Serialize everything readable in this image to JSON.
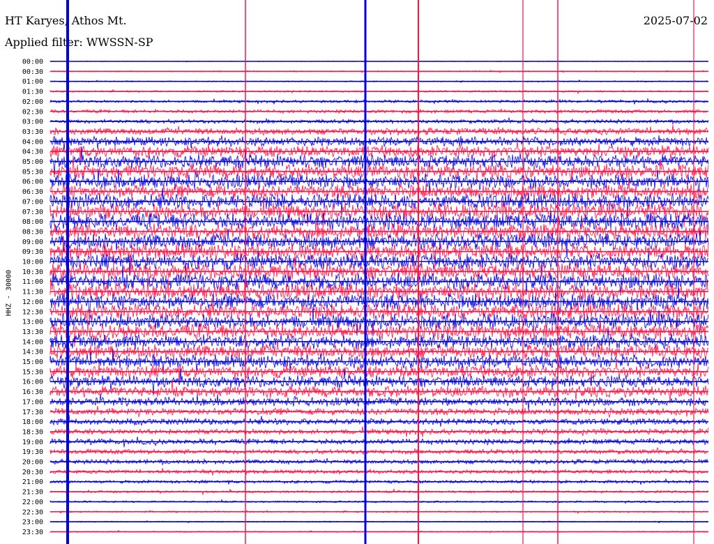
{
  "header": {
    "station": "HT Karyes, Athos Mt.",
    "filter": "Applied filter: WWSSN-SP",
    "date": "2025-07-02"
  },
  "chart_data": {
    "type": "line",
    "title": "HT Karyes, Athos Mt.",
    "subtitle": "Applied filter: WWSSN-SP",
    "date": "2025-07-02",
    "ylabel": "HHZ - 30000",
    "row_labels": [
      "00:00",
      "00:30",
      "01:00",
      "01:30",
      "02:00",
      "02:30",
      "03:00",
      "03:30",
      "04:00",
      "04:30",
      "05:00",
      "05:30",
      "06:00",
      "06:30",
      "07:00",
      "07:30",
      "08:00",
      "08:30",
      "09:00",
      "09:30",
      "10:00",
      "10:30",
      "11:00",
      "11:30",
      "12:00",
      "12:30",
      "13:00",
      "13:30",
      "14:00",
      "14:30",
      "15:00",
      "15:30",
      "16:00",
      "16:30",
      "17:00",
      "17:30",
      "18:00",
      "18:30",
      "19:00",
      "19:30",
      "20:00",
      "20:30",
      "21:00",
      "21:30",
      "22:00",
      "22:30",
      "23:00",
      "23:30"
    ],
    "trace_colors": [
      "#0000dd",
      "#ff1144"
    ],
    "noise_amplitude": [
      0.05,
      0.08,
      0.08,
      0.12,
      0.18,
      0.22,
      0.25,
      0.45,
      0.6,
      0.75,
      0.85,
      0.9,
      0.9,
      0.9,
      0.95,
      1.0,
      1.0,
      1.0,
      1.0,
      1.0,
      1.0,
      1.0,
      1.0,
      1.0,
      1.0,
      0.95,
      0.95,
      0.95,
      0.9,
      0.9,
      0.85,
      0.8,
      0.75,
      0.7,
      0.55,
      0.45,
      0.4,
      0.35,
      0.35,
      0.3,
      0.3,
      0.25,
      0.2,
      0.15,
      0.12,
      0.1,
      0.08,
      0.08
    ],
    "grid": false,
    "legend": "none"
  }
}
